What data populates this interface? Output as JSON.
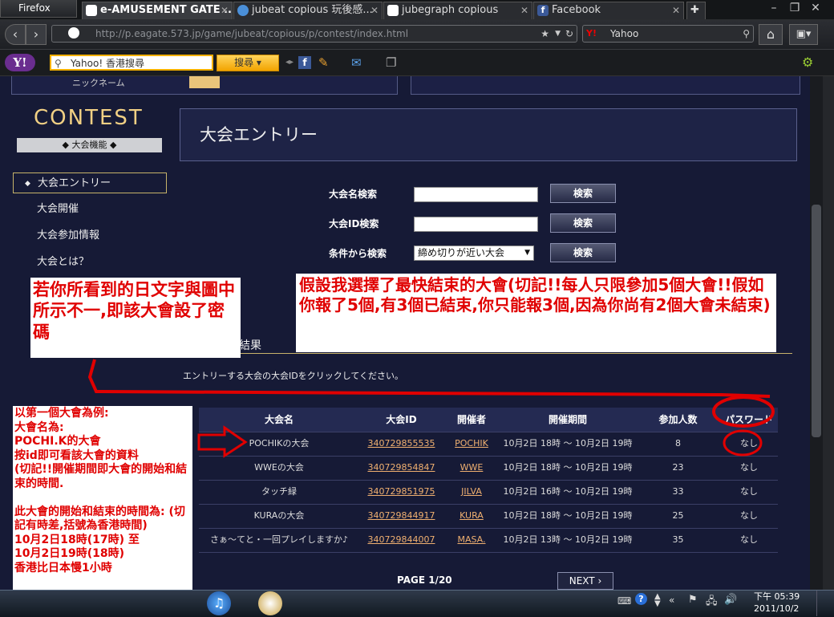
{
  "browser": {
    "app_button": "Firefox",
    "tabs": [
      {
        "label": "e-AMUSEMENT GATE ...",
        "active": true
      },
      {
        "label": "jubeat copious 玩後感..."
      },
      {
        "label": "jubegraph copious"
      },
      {
        "label": "Facebook"
      }
    ],
    "url": "http://p.eagate.573.jp/game/jubeat/copious/p/contest/index.html",
    "search_engine": "Yahoo",
    "yahoo_toolbar": {
      "logo": "Y!",
      "search_placeholder": "Yahoo! 香港搜尋",
      "search_button": "搜尋"
    }
  },
  "sidebar": {
    "logo": "CONTEST",
    "section_label": "◆ 大会機能 ◆",
    "items": [
      {
        "label": "大会エントリー",
        "selected": true
      },
      {
        "label": "大会開催"
      },
      {
        "label": "大会参加情報"
      },
      {
        "label": "大会とは？"
      }
    ]
  },
  "profile_label": "ニックネーム",
  "main": {
    "title": "大会エントリー",
    "search": {
      "name_label": "大会名検索",
      "id_label": "大会ID検索",
      "condition_label": "条件から検索",
      "condition_value": "締め切りが近い大会",
      "button_label": "検索"
    },
    "results_heading": "結果",
    "instruction": "エントリーする大会の大会IDをクリックしてください。",
    "table": {
      "headers": [
        "大会名",
        "大会ID",
        "開催者",
        "開催期間",
        "参加人数",
        "パスワード"
      ],
      "rows": [
        {
          "name": "POCHIKの大会",
          "id": "340729855535",
          "host": "POCHIK",
          "period": "10月2日 18時 ～ 10月2日 19時",
          "count": "8",
          "password": "なし"
        },
        {
          "name": "WWEの大会",
          "id": "340729854847",
          "host": "WWE",
          "period": "10月2日 18時 ～ 10月2日 19時",
          "count": "23",
          "password": "なし"
        },
        {
          "name": "タッチ緑",
          "id": "340729851975",
          "host": "JILVA",
          "period": "10月2日 16時 ～ 10月2日 19時",
          "count": "33",
          "password": "なし"
        },
        {
          "name": "KURAの大会",
          "id": "340729844917",
          "host": "KURA",
          "period": "10月2日 18時 ～ 10月2日 19時",
          "count": "25",
          "password": "なし"
        },
        {
          "name": "さぁ～てと・一回プレイしますか♪",
          "id": "340729844007",
          "host": "MASA.",
          "period": "10月2日 13時 ～ 10月2日 19時",
          "count": "35",
          "password": "なし"
        }
      ]
    },
    "pager": "PAGE 1/20",
    "next_label": "NEXT"
  },
  "annotations": {
    "note_password": "若你所看到的日文字與圖中所示不一,即該大會設了密碼",
    "note_selection": "假設我選擇了最快結束的大會(切記!!每人只限參加5個大會!!假如你報了5個,有3個已結束,你只能報3個,因為你尚有2個大會未結束)",
    "note_example": "以第一個大會為例:\n大會名為:\nPOCHI.K的大會\n按id即可看該大會的資料\n(切記!!開催期間即大會的開始和結束的時間.\n\n此大會的開始和結束的時間為: (切記有時差,括號為香港時間)\n10月2日18時(17時) 至\n10月2日19時(18時)\n香港比日本慢1小時"
  },
  "taskbar": {
    "time": "下午 05:39",
    "date": "2011/10/2"
  },
  "colors": {
    "page_bg": "#161a36",
    "accent_gold": "#f1d084",
    "link": "#f0b070",
    "annotation_red": "#e00000"
  }
}
